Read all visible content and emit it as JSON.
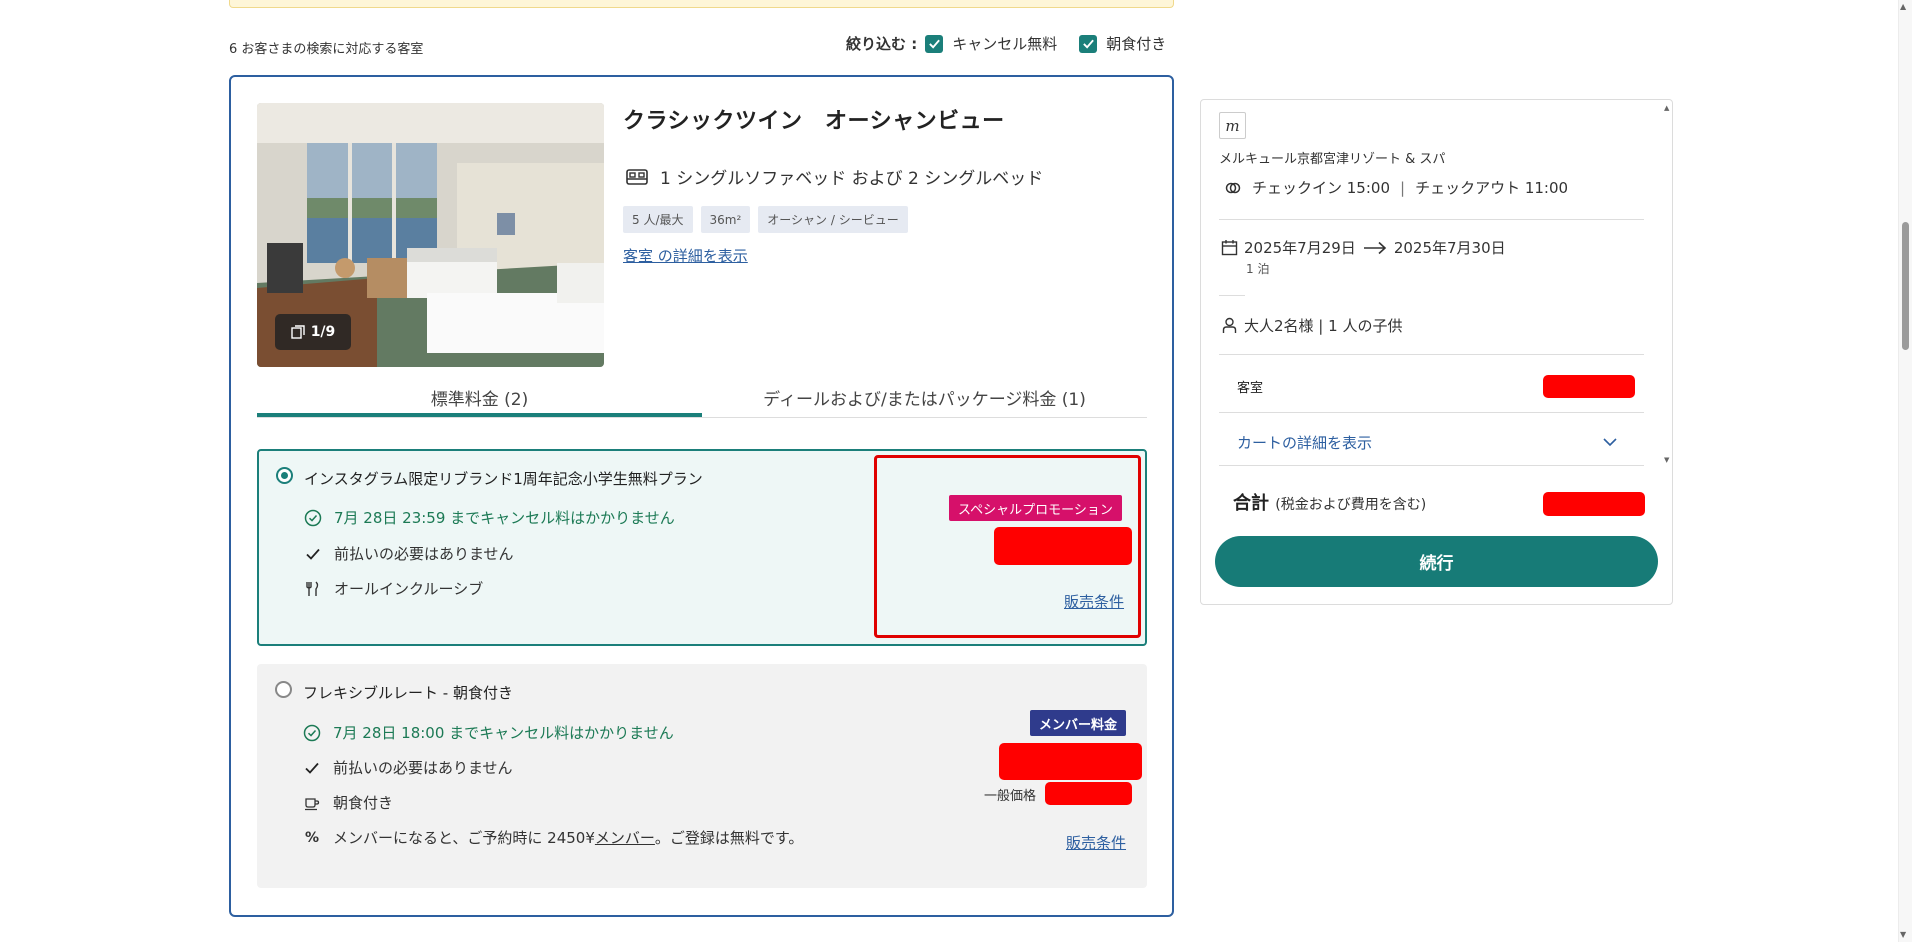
{
  "results": {
    "count_text": "6 お客さまの検索に対応する客室",
    "filter_label": "絞り込む :",
    "filters": [
      "キャンセル無料",
      "朝食付き"
    ]
  },
  "room": {
    "title": "クラシックツイン　オーシャンビュー",
    "photo_counter": "1/9",
    "bed_text": "1 シングルソファベッド および 2 シングルベッド",
    "tags": [
      "5 人/最大",
      "36m²",
      "オーシャン / シービュー"
    ],
    "details_link": "客室 の詳細を表示"
  },
  "tabs": [
    {
      "label": "標準料金 (2)",
      "active": true
    },
    {
      "label": "ディールおよび/またはパッケージ料金 (1)",
      "active": false
    }
  ],
  "rates": [
    {
      "name": "インスタグラム限定リブランド1周年記念小学生無料プラン",
      "selected": true,
      "cancellation": "7月 28日 23:59 までキャンセル料はかかりません",
      "prepay": "前払いの必要はありません",
      "meal": "オールインクルーシブ",
      "badge": "スペシャルプロモーション",
      "sales_link": "販売条件"
    },
    {
      "name": "フレキシブルレート - 朝食付き",
      "selected": false,
      "cancellation": "7月 28日 18:00 までキャンセル料はかかりません",
      "prepay": "前払いの必要はありません",
      "meal": "朝食付き",
      "member_prefix": "メンバーになると、ご予約時に 2450¥",
      "member_link": "メンバー",
      "member_suffix": "。ご登録は無料です。",
      "badge": "メンバー料金",
      "general_price_label": "一般価格",
      "sales_link": "販売条件"
    }
  ],
  "summary": {
    "logo_letter": "m",
    "hotel_name": "メルキュール京都宮津リゾート & スパ",
    "checkin": "チェックイン 15:00",
    "separator": "|",
    "checkout": "チェックアウト 11:00",
    "date_from": "2025年7月29日",
    "date_to": "2025年7月30日",
    "nights": "1 泊",
    "guests": "大人2名様 | 1 人の子供",
    "room_label": "客室",
    "cart_details": "カートの詳細を表示",
    "total_label": "合計",
    "total_sub": "(税金および費用を含む)",
    "continue_button": "続行"
  },
  "colors": {
    "accent_teal": "#1b7f7a",
    "card_border_blue": "#2d5fa0",
    "promo_pink": "#d6106a",
    "member_navy": "#2f3b8c",
    "redaction_red": "#ff0000"
  }
}
